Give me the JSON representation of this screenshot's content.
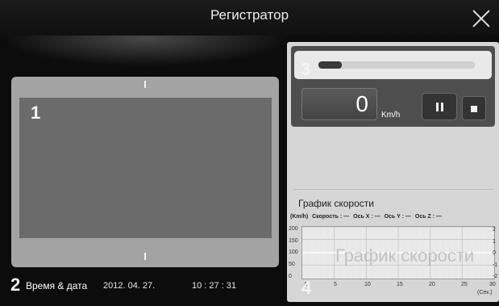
{
  "app": {
    "title": "Регистратор"
  },
  "badges": {
    "video": "1",
    "datetime": "2",
    "controls": "3",
    "graph": "4"
  },
  "datetime": {
    "label": "Время & дата",
    "date": "2012. 04. 27.",
    "time": "10 : 27 : 31"
  },
  "controls": {
    "progress_fraction": 0.15,
    "speed_value": "0",
    "speed_unit": "Km/h"
  },
  "graph": {
    "title": "График скорости",
    "watermark": "График скорости",
    "legend": [
      "(Km/h)",
      "Скорость : —",
      "Ось X : —",
      "Ось Y : —",
      "Ось Z : —"
    ],
    "y_ticks": [
      "200",
      "150",
      "100",
      "50",
      "0"
    ],
    "x_ticks": [
      "0",
      "5",
      "10",
      "15",
      "20",
      "25",
      "30"
    ],
    "x_unit": "(Сек.)",
    "right_clip_labels": [
      "2",
      "1",
      "0",
      "-1",
      "-2"
    ]
  },
  "colors": {
    "background": "#0c0c0c",
    "panel": "#d6d6d6",
    "video": "#6b6b6b"
  },
  "icons": {
    "close": "close-icon",
    "pause": "pause-icon",
    "stop": "stop-icon"
  }
}
